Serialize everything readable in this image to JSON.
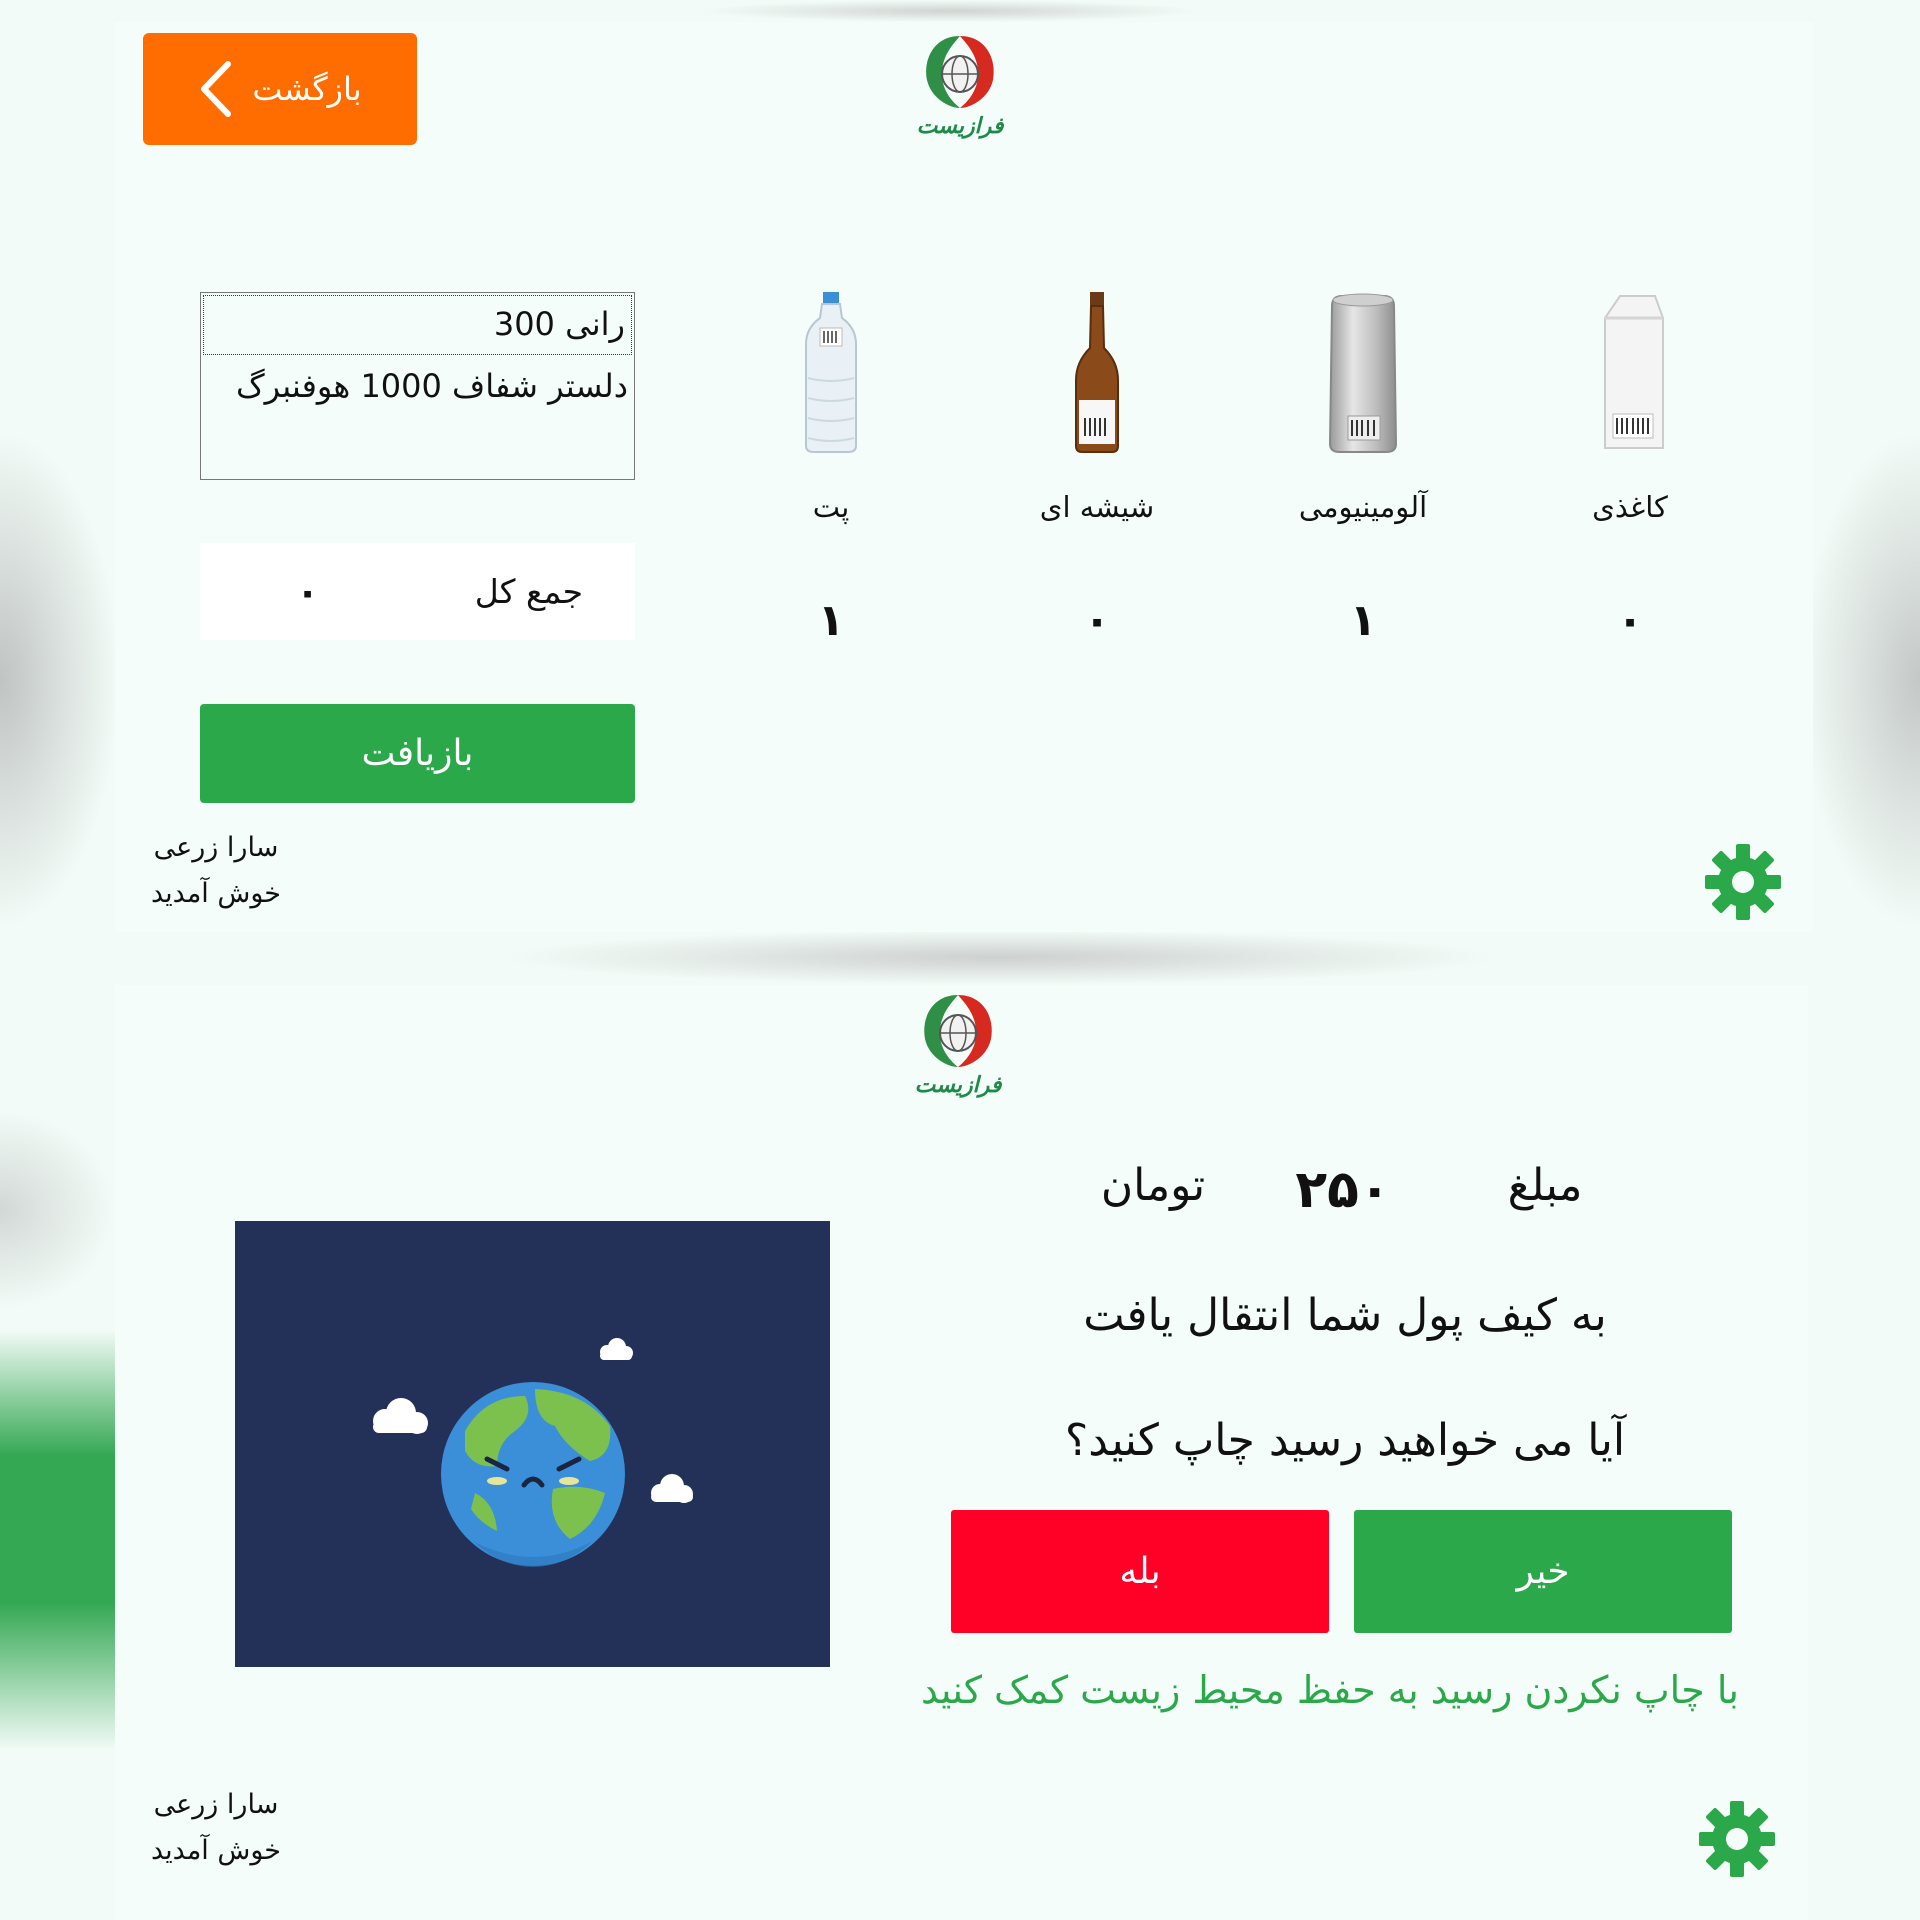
{
  "top_screen": {
    "back_button_label": "بازگشت",
    "logo_text": "فرازیست",
    "items": [
      {
        "label": "کاغذی",
        "count": "۰",
        "icon": "paper-carton-icon"
      },
      {
        "label": "آلومینیومی",
        "count": "۱",
        "icon": "aluminum-can-icon"
      },
      {
        "label": "شیشه ای",
        "count": "۰",
        "icon": "glass-bottle-icon"
      },
      {
        "label": "پت",
        "count": "۱",
        "icon": "pet-bottle-icon"
      }
    ],
    "products": [
      "رانی 300",
      "دلستر شفاف 1000 هوفنبرگ"
    ],
    "total_label": "جمع کل",
    "total_value": "۰",
    "recycle_button_label": "بازیافت",
    "user_name": "سارا زرعی",
    "welcome": "خوش آمدید"
  },
  "bottom_screen": {
    "logo_text": "فرازیست",
    "amount_label": "مبلغ",
    "amount_value": "۲۵۰",
    "amount_unit": "تومان",
    "transfer_text": "به کیف پول شما انتقال یافت",
    "question_text": "آیا می خواهید رسید چاپ کنید؟",
    "no_button_label": "خیر",
    "yes_button_label": "بله",
    "hint_text": "با چاپ نکردن رسید به حفظ محیط زیست کمک کنید",
    "user_name": "سارا زرعی",
    "welcome": "خوش آمدید"
  },
  "colors": {
    "accent_orange": "#ff6d00",
    "accent_green": "#2ba84a",
    "accent_red": "#ff0026",
    "earth_bg": "#233158"
  }
}
